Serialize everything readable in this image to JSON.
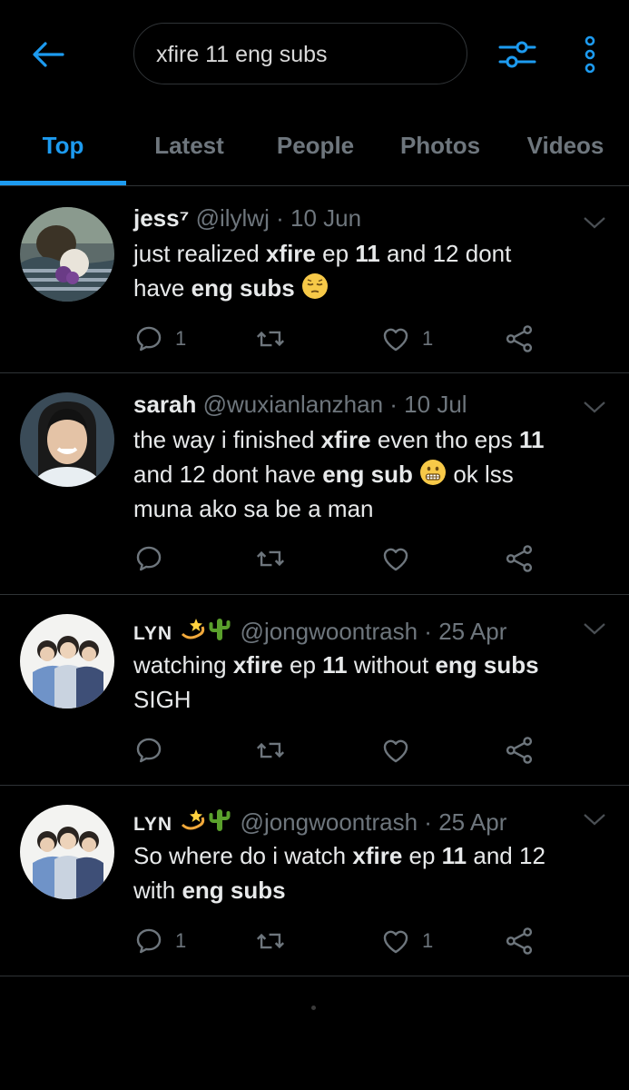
{
  "search": {
    "query": "xfire 11 eng subs"
  },
  "tabs": [
    {
      "label": "Top"
    },
    {
      "label": "Latest"
    },
    {
      "label": "People"
    },
    {
      "label": "Photos"
    },
    {
      "label": "Videos"
    }
  ],
  "active_tab": "Top",
  "colors": {
    "accent": "#1d9bf0",
    "muted": "#6e767d",
    "text": "#e7e9ea",
    "divider": "#2f3336"
  },
  "tweets": [
    {
      "name": "jess⁷",
      "handle": "@ilylwj",
      "sep": "·",
      "date": "10 Jun",
      "text": {
        "p1": "just realized ",
        "b1": "xfire",
        "p2": " ep ",
        "b2": "11",
        "p3": " and 12 dont",
        "p4": "have ",
        "b3": "eng subs",
        "emoji_icon": "pensive-face-emoji"
      },
      "replies": "1",
      "retweets": "",
      "likes": "1"
    },
    {
      "name": "sarah",
      "handle": "@wuxianlanzhan",
      "sep": "·",
      "date": "10 Jul",
      "text": {
        "p1": "the way i finished ",
        "b1": "xfire",
        "p2": " even tho eps ",
        "b2": "11",
        "p3": "and 12 dont have ",
        "b3": "eng sub",
        "emoji_icon": "grimacing-face-emoji",
        "p4": " ok lss",
        "p5": "muna ako sa be a man"
      },
      "replies": "",
      "retweets": "",
      "likes": ""
    },
    {
      "name": "LYN",
      "name_icons": [
        "dizzy-emoji",
        "cactus-emoji"
      ],
      "handle": "@jongwoontrash",
      "sep": "·",
      "date": "25 Apr",
      "text": {
        "p1": "watching ",
        "b1": "xfire",
        "p2": " ep ",
        "b2": "11",
        "p3": " without ",
        "b3": "eng subs",
        "p4": "SIGH"
      },
      "replies": "",
      "retweets": "",
      "likes": ""
    },
    {
      "name": "LYN",
      "name_icons": [
        "dizzy-emoji",
        "cactus-emoji"
      ],
      "handle": "@jongwoontrash",
      "sep": "·",
      "date": "25 Apr",
      "text": {
        "p1": "So where do i watch ",
        "b1": "xfire",
        "p2": " ep ",
        "b2": "11",
        "p3": " and 12",
        "p4": "with ",
        "b3": "eng subs"
      },
      "replies": "1",
      "retweets": "",
      "likes": "1"
    }
  ]
}
